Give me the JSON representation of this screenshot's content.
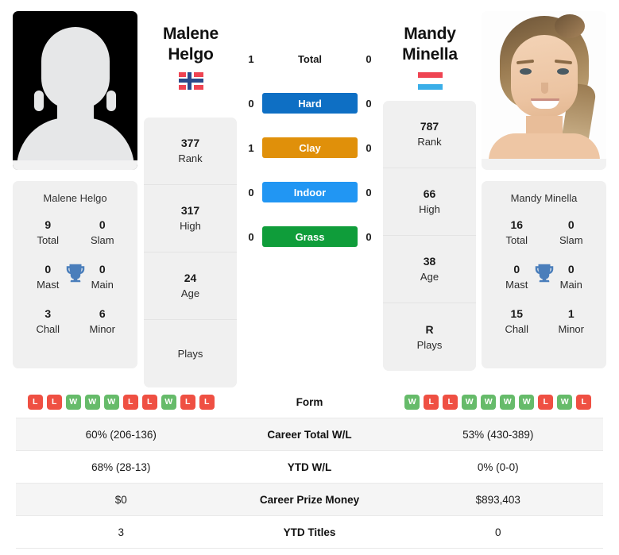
{
  "players": {
    "left": {
      "first_name": "Malene",
      "last_name": "Helgo",
      "full_name": "Malene Helgo",
      "country": "Norway",
      "avatar": "placeholder-silhouette",
      "rank": "377",
      "rank_label": "Rank",
      "high": "317",
      "high_label": "High",
      "age": "24",
      "age_label": "Age",
      "plays": "",
      "plays_label": "Plays",
      "titles": {
        "total": "9",
        "total_label": "Total",
        "slam": "0",
        "slam_label": "Slam",
        "mast": "0",
        "mast_label": "Mast",
        "main": "0",
        "main_label": "Main",
        "chall": "3",
        "chall_label": "Chall",
        "minor": "6",
        "minor_label": "Minor"
      },
      "form": [
        "L",
        "L",
        "W",
        "W",
        "W",
        "L",
        "L",
        "W",
        "L",
        "L"
      ],
      "career_total_wl": "60% (206-136)",
      "ytd_wl": "68% (28-13)",
      "career_prize_money": "$0",
      "ytd_titles": "3"
    },
    "right": {
      "first_name": "Mandy",
      "last_name": "Minella",
      "full_name": "Mandy Minella",
      "country": "Luxembourg",
      "avatar": "player-photo",
      "rank": "787",
      "rank_label": "Rank",
      "high": "66",
      "high_label": "High",
      "age": "38",
      "age_label": "Age",
      "plays": "R",
      "plays_label": "Plays",
      "titles": {
        "total": "16",
        "total_label": "Total",
        "slam": "0",
        "slam_label": "Slam",
        "mast": "0",
        "mast_label": "Mast",
        "main": "0",
        "main_label": "Main",
        "chall": "15",
        "chall_label": "Chall",
        "minor": "1",
        "minor_label": "Minor"
      },
      "form": [
        "W",
        "L",
        "L",
        "W",
        "W",
        "W",
        "W",
        "L",
        "W",
        "L"
      ],
      "career_total_wl": "53% (430-389)",
      "ytd_wl": "0% (0-0)",
      "career_prize_money": "$893,403",
      "ytd_titles": "0"
    }
  },
  "head_to_head": [
    {
      "label": "Total",
      "left": "1",
      "right": "0",
      "style": "plain",
      "color": ""
    },
    {
      "label": "Hard",
      "left": "0",
      "right": "0",
      "style": "bar",
      "color": "#0e6fc4"
    },
    {
      "label": "Clay",
      "left": "1",
      "right": "0",
      "style": "bar",
      "color": "#e0900a"
    },
    {
      "label": "Indoor",
      "left": "0",
      "right": "0",
      "style": "bar",
      "color": "#2196f3"
    },
    {
      "label": "Grass",
      "left": "0",
      "right": "0",
      "style": "bar",
      "color": "#0f9d3a"
    }
  ],
  "table": {
    "rows": [
      {
        "label": "Form",
        "type": "form"
      },
      {
        "label": "Career Total W/L",
        "type": "text",
        "key": "career_total_wl"
      },
      {
        "label": "YTD W/L",
        "type": "text",
        "key": "ytd_wl"
      },
      {
        "label": "Career Prize Money",
        "type": "text",
        "key": "career_prize_money"
      },
      {
        "label": "YTD Titles",
        "type": "text",
        "key": "ytd_titles"
      }
    ]
  },
  "colors": {
    "win_badge": "#66bb6a",
    "loss_badge": "#ef5043",
    "card_bg": "#f0f0f0",
    "row_alt_bg": "#f5f5f5",
    "trophy": "#4a7ebb"
  }
}
